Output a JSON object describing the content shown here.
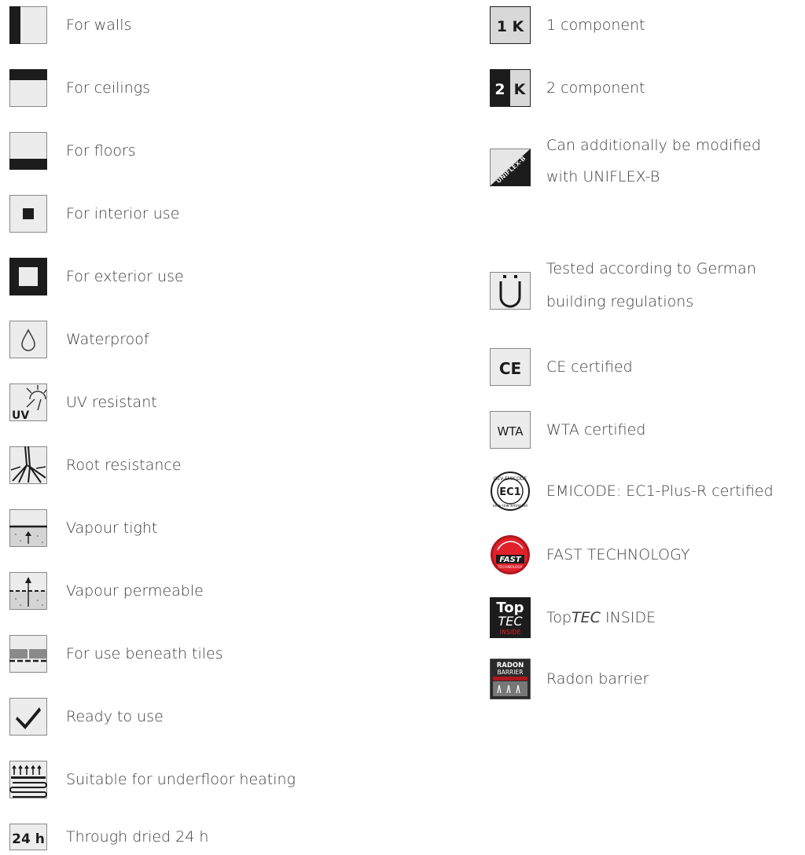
{
  "left_column": [
    {
      "icon": "for-walls-icon",
      "label": "For walls"
    },
    {
      "icon": "for-ceilings-icon",
      "label": "For ceilings"
    },
    {
      "icon": "for-floors-icon",
      "label": "For floors"
    },
    {
      "icon": "interior-use-icon",
      "label": "For interior use"
    },
    {
      "icon": "exterior-use-icon",
      "label": "For exterior use"
    },
    {
      "icon": "waterproof-drop-icon",
      "label": "Waterproof"
    },
    {
      "icon": "uv-resistant-icon",
      "label": "UV resistant",
      "icon_text": "UV"
    },
    {
      "icon": "root-resistance-icon",
      "label": "Root resistance"
    },
    {
      "icon": "vapour-tight-icon",
      "label": "Vapour tight"
    },
    {
      "icon": "vapour-permeable-icon",
      "label": "Vapour permeable"
    },
    {
      "icon": "beneath-tiles-icon",
      "label": "For use beneath tiles"
    },
    {
      "icon": "ready-to-use-check-icon",
      "label": "Ready to use"
    },
    {
      "icon": "underfloor-heating-icon",
      "label": "Suitable for underfloor heating"
    },
    {
      "icon": "through-dried-24h-icon",
      "label": "Through dried 24 h",
      "icon_text": "24 h"
    }
  ],
  "right_column": [
    {
      "icon": "one-component-icon",
      "label": "1 component",
      "icon_text": "1 K"
    },
    {
      "icon": "two-component-icon",
      "label": "2 component",
      "icon_text_a": "2",
      "icon_text_b": "K"
    },
    {
      "icon": "uniflex-b-icon",
      "label_line1": "Can additionally be modified",
      "label_line2": "with UNIFLEX-B",
      "icon_text": "UNIFLEX-B"
    },
    {
      "icon": "german-building-regulations-u-icon",
      "label_line1": "Tested according to German",
      "label_line2": "building regulations",
      "icon_text": "Ü"
    },
    {
      "icon": "ce-certified-icon",
      "label": "CE certified",
      "icon_text": "CE"
    },
    {
      "icon": "wta-certified-icon",
      "label": "WTA certified",
      "icon_text": "WTA"
    },
    {
      "icon": "emicode-ec1-icon",
      "label": "EMICODE: EC1-Plus-R certified",
      "icon_text": "EC1",
      "icon_ring_top": "GEV-EMICODE",
      "icon_ring_bottom": "very low emission"
    },
    {
      "icon": "fast-technology-icon",
      "label": "FAST TECHNOLOGY",
      "icon_text": "FAST",
      "icon_subtext": "TECHNOLOGY"
    },
    {
      "icon": "toptec-inside-icon",
      "label_a": "Top",
      "label_b": "TEC",
      "label_c": " INSIDE",
      "icon_text_a": "Top",
      "icon_text_b": "TEC",
      "icon_text_c": "INSIDE"
    },
    {
      "icon": "radon-barrier-icon",
      "label": "Radon barrier",
      "icon_text_a": "RADON",
      "icon_text_b": "BARRIER"
    }
  ]
}
